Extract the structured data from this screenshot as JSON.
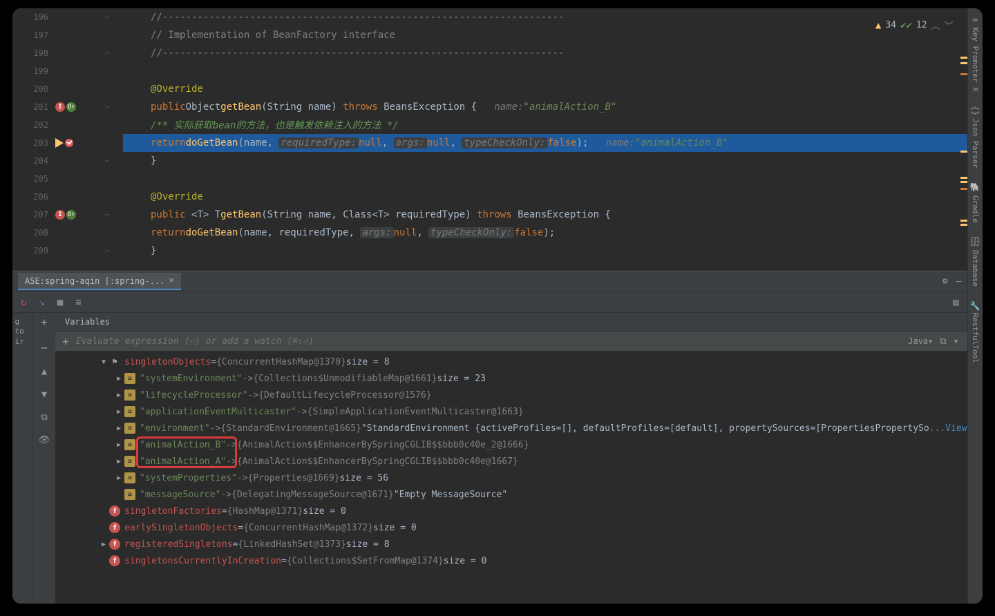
{
  "editor": {
    "warnings_count": "34",
    "checks_count": "12",
    "lines": [
      {
        "num": "196",
        "icons": [],
        "fold": "−",
        "html": "<span class='k-comment'>//---------------------------------------------------------------------</span>"
      },
      {
        "num": "197",
        "icons": [],
        "fold": "",
        "html": "<span class='k-comment'>// Implementation of BeanFactory interface</span>"
      },
      {
        "num": "198",
        "icons": [],
        "fold": "−",
        "html": "<span class='k-comment'>//---------------------------------------------------------------------</span>"
      },
      {
        "num": "199",
        "icons": [],
        "fold": "",
        "html": ""
      },
      {
        "num": "200",
        "icons": [],
        "fold": "",
        "html": "<span class='k-annotation'>@Override</span>"
      },
      {
        "num": "201",
        "icons": [
          "impl",
          "over"
        ],
        "fold": "−",
        "html": "<span class='k-keyword'>public</span> <span class='k-type'>Object</span> <span class='k-method'>getBean</span>(String <span class='k-param'>name</span>) <span class='k-keyword'>throws</span> BeansException {   <span class='k-hint'>name:</span> <span class='k-hint-val'>\"animalAction_B\"</span>"
      },
      {
        "num": "202",
        "icons": [],
        "fold": "",
        "html": "    <span class='k-doc'>/** 实际获取bean的方法，也是触发依赖注入的方法 */</span>"
      },
      {
        "num": "203",
        "icons": [
          "exec",
          "bp"
        ],
        "fold": "",
        "highlighted": true,
        "html": "    <span class='k-keyword'>return</span> <span class='k-method'>doGetBean</span>(name, <span class='k-hint-box'>requiredType:</span> <span class='k-null'>null</span>, <span class='k-hint-box'>args:</span> <span class='k-null'>null</span>, <span class='k-hint-box'>typeCheckOnly:</span> <span class='k-false'>false</span>);   <span class='k-hint'>name:</span> <span class='k-hint-val'>\"animalAction_B\"</span>"
      },
      {
        "num": "204",
        "icons": [],
        "fold": "−",
        "html": "<span class='k-type'>}</span>"
      },
      {
        "num": "205",
        "icons": [],
        "fold": "",
        "html": ""
      },
      {
        "num": "206",
        "icons": [],
        "fold": "",
        "html": "<span class='k-annotation'>@Override</span>"
      },
      {
        "num": "207",
        "icons": [
          "impl",
          "over"
        ],
        "fold": "−",
        "html": "<span class='k-keyword'>public</span> &lt;<span class='k-type'>T</span>&gt; <span class='k-type'>T</span> <span class='k-method'>getBean</span>(String <span class='k-param'>name</span>, Class&lt;<span class='k-type'>T</span>&gt; <span class='k-param'>requiredType</span>) <span class='k-keyword'>throws</span> BeansException {"
      },
      {
        "num": "208",
        "icons": [],
        "fold": "",
        "html": "    <span class='k-keyword'>return</span> <span class='k-method'>doGetBean</span>(name, requiredType, <span class='k-hint-box'>args:</span> <span class='k-null'>null</span>, <span class='k-hint-box'>typeCheckOnly:</span> <span class='k-false'>false</span>);"
      },
      {
        "num": "209",
        "icons": [],
        "fold": "−",
        "html": "<span class='k-type'>}</span>"
      }
    ]
  },
  "debug": {
    "tab_label": "ASE:spring-aqin [:spring-...",
    "vars_title": "Variables",
    "watch_placeholder": "Evaluate expression (⏎) or add a watch (⌘⇧⏎)",
    "lang": "Java",
    "left_gutter": "g\nto\nir",
    "tree": [
      {
        "indent": 1,
        "arrow": "down",
        "icon": "flag",
        "parts": [
          {
            "cls": "var-name",
            "t": "singletonObjects"
          },
          {
            "cls": "var-eq",
            "t": " = "
          },
          {
            "cls": "var-obj",
            "t": "{ConcurrentHashMap@1370} "
          },
          {
            "cls": "var-size",
            "t": " size = 8"
          }
        ]
      },
      {
        "indent": 2,
        "arrow": "right",
        "icon": "map",
        "parts": [
          {
            "cls": "var-key",
            "t": "\"systemEnvironment\""
          },
          {
            "cls": "var-arrow",
            "t": " -> "
          },
          {
            "cls": "var-obj",
            "t": "{Collections$UnmodifiableMap@1661} "
          },
          {
            "cls": "var-size",
            "t": " size = 23"
          }
        ]
      },
      {
        "indent": 2,
        "arrow": "right",
        "icon": "map",
        "parts": [
          {
            "cls": "var-key",
            "t": "\"lifecycleProcessor\""
          },
          {
            "cls": "var-arrow",
            "t": " -> "
          },
          {
            "cls": "var-obj",
            "t": "{DefaultLifecycleProcessor@1576}"
          }
        ]
      },
      {
        "indent": 2,
        "arrow": "right",
        "icon": "map",
        "parts": [
          {
            "cls": "var-key",
            "t": "\"applicationEventMulticaster\""
          },
          {
            "cls": "var-arrow",
            "t": " -> "
          },
          {
            "cls": "var-obj",
            "t": "{SimpleApplicationEventMulticaster@1663}"
          }
        ]
      },
      {
        "indent": 2,
        "arrow": "right",
        "icon": "map",
        "parts": [
          {
            "cls": "var-key",
            "t": "\"environment\""
          },
          {
            "cls": "var-arrow",
            "t": " -> "
          },
          {
            "cls": "var-obj",
            "t": "{StandardEnvironment@1665} "
          },
          {
            "cls": "var-str",
            "t": "\"StandardEnvironment {activeProfiles=[], defaultProfiles=[default], propertySources=[PropertiesPropertySo"
          },
          {
            "cls": "var-obj",
            "t": "... "
          },
          {
            "cls": "view-link",
            "t": "View"
          }
        ]
      },
      {
        "indent": 2,
        "arrow": "right",
        "icon": "map",
        "parts": [
          {
            "cls": "var-key",
            "t": "\"animalAction_B\""
          },
          {
            "cls": "var-arrow",
            "t": " -> "
          },
          {
            "cls": "var-obj",
            "t": "{AnimalAction$$EnhancerBySpringCGLIB$$bbb0c40e_2@1666}"
          }
        ],
        "highlight": "top"
      },
      {
        "indent": 2,
        "arrow": "right",
        "icon": "map",
        "parts": [
          {
            "cls": "var-key",
            "t": "\"animalAction_A\""
          },
          {
            "cls": "var-arrow",
            "t": " -> "
          },
          {
            "cls": "var-obj",
            "t": "{AnimalAction$$EnhancerBySpringCGLIB$$bbb0c40e@1667}"
          }
        ],
        "highlight": "bottom"
      },
      {
        "indent": 2,
        "arrow": "right",
        "icon": "map",
        "parts": [
          {
            "cls": "var-key",
            "t": "\"systemProperties\""
          },
          {
            "cls": "var-arrow",
            "t": " -> "
          },
          {
            "cls": "var-obj",
            "t": "{Properties@1669} "
          },
          {
            "cls": "var-size",
            "t": " size = 56"
          }
        ]
      },
      {
        "indent": 2,
        "arrow": "none",
        "icon": "map",
        "parts": [
          {
            "cls": "var-key",
            "t": "\"messageSource\""
          },
          {
            "cls": "var-arrow",
            "t": " -> "
          },
          {
            "cls": "var-obj",
            "t": "{DelegatingMessageSource@1671} "
          },
          {
            "cls": "var-str",
            "t": "\"Empty MessageSource\""
          }
        ]
      },
      {
        "indent": 1,
        "arrow": "none",
        "icon": "f",
        "parts": [
          {
            "cls": "var-name",
            "t": "singletonFactories"
          },
          {
            "cls": "var-eq",
            "t": " = "
          },
          {
            "cls": "var-obj",
            "t": "{HashMap@1371} "
          },
          {
            "cls": "var-size",
            "t": " size = 0"
          }
        ]
      },
      {
        "indent": 1,
        "arrow": "none",
        "icon": "f",
        "parts": [
          {
            "cls": "var-name",
            "t": "earlySingletonObjects"
          },
          {
            "cls": "var-eq",
            "t": " = "
          },
          {
            "cls": "var-obj",
            "t": "{ConcurrentHashMap@1372} "
          },
          {
            "cls": "var-size",
            "t": " size = 0"
          }
        ]
      },
      {
        "indent": 1,
        "arrow": "right",
        "icon": "f",
        "parts": [
          {
            "cls": "var-name",
            "t": "registeredSingletons"
          },
          {
            "cls": "var-eq",
            "t": " = "
          },
          {
            "cls": "var-obj",
            "t": "{LinkedHashSet@1373} "
          },
          {
            "cls": "var-size",
            "t": " size = 8"
          }
        ]
      },
      {
        "indent": 1,
        "arrow": "none",
        "icon": "f",
        "parts": [
          {
            "cls": "var-name",
            "t": "singletonsCurrentlyInCreation"
          },
          {
            "cls": "var-eq",
            "t": " = "
          },
          {
            "cls": "var-obj",
            "t": "{Collections$SetFromMap@1374} "
          },
          {
            "cls": "var-size",
            "t": " size = 0"
          }
        ]
      }
    ]
  },
  "sidebar": {
    "items": [
      "Key Promoter X",
      "Json Parser",
      "Gradle",
      "Database",
      "RestfulTool"
    ]
  }
}
